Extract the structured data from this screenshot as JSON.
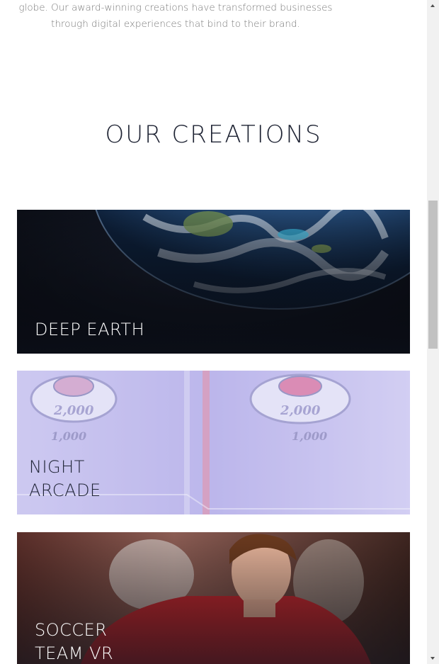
{
  "intro": {
    "line1": "globe. Our award-winning creations have transformed businesses",
    "line2": "through digital experiences that bind to their brand."
  },
  "section": {
    "title": "OUR CREATIONS"
  },
  "creations": [
    {
      "line1": "DEEP EARTH",
      "line2": ""
    },
    {
      "line1": "NIGHT",
      "line2": "ARCADE"
    },
    {
      "line1": "SOCCER",
      "line2": "TEAM VR"
    }
  ],
  "scrollbar": {
    "position": 0.3
  }
}
